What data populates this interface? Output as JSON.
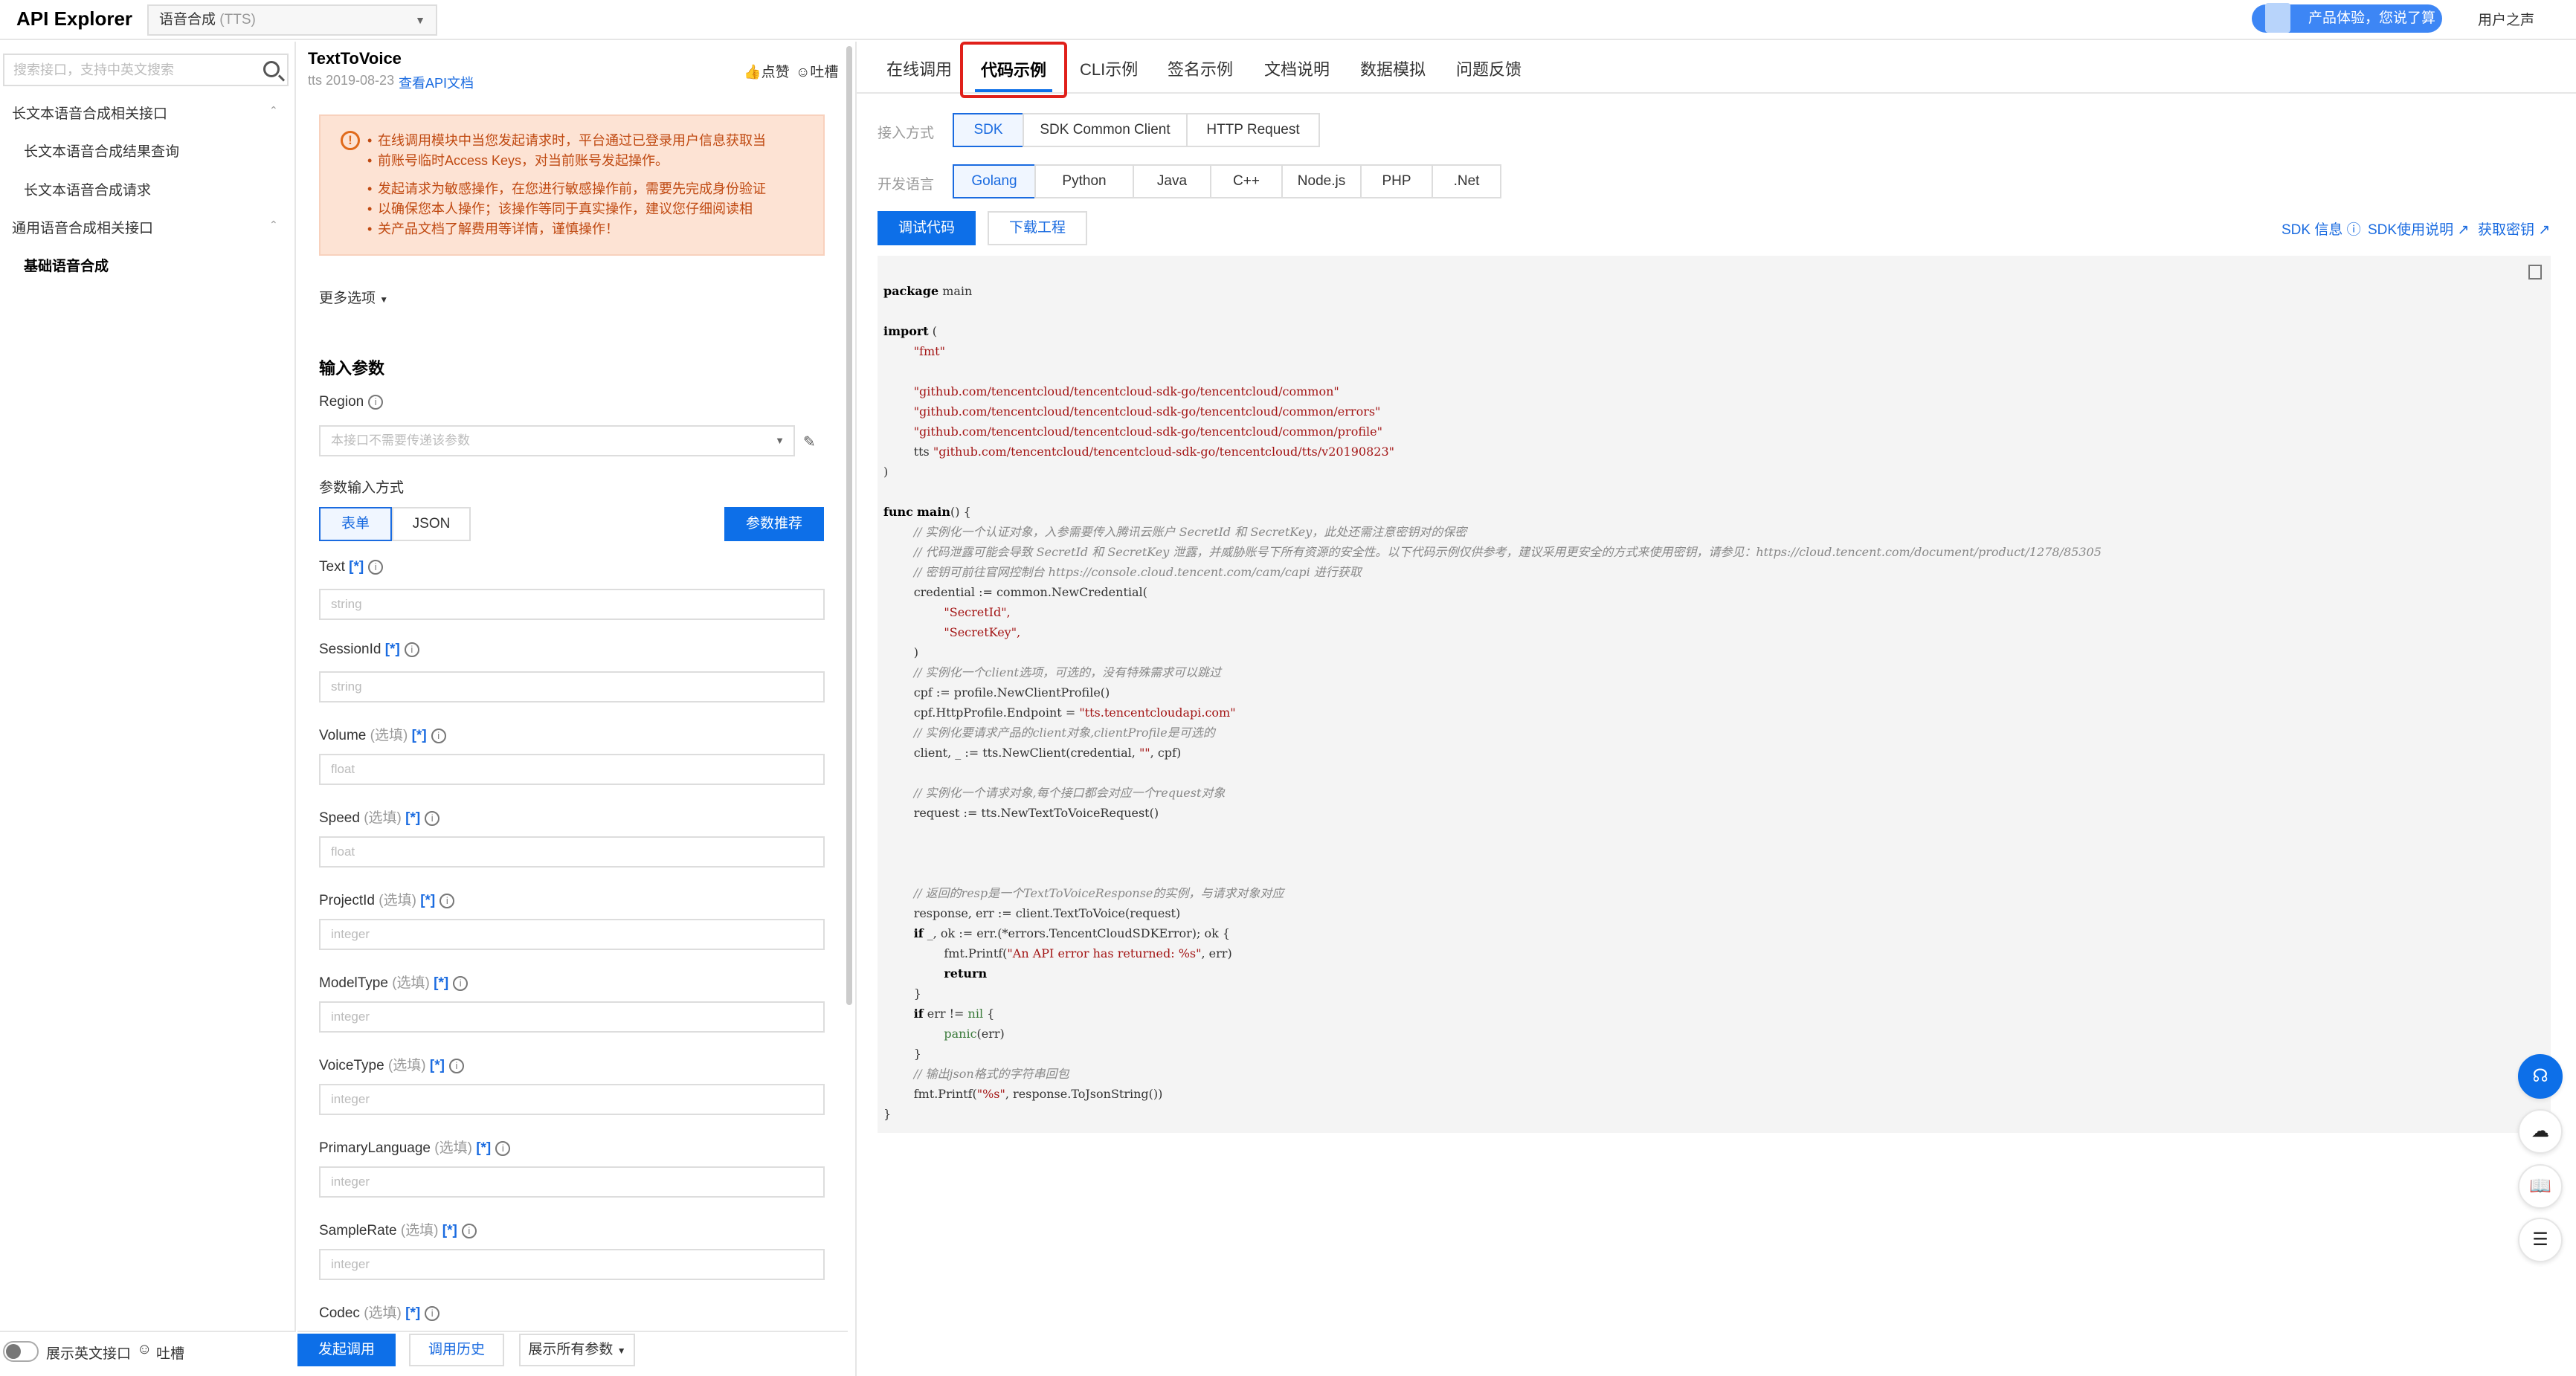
{
  "header": {
    "brand": "API Explorer",
    "product_select": "语音合成",
    "product_code": "(TTS)",
    "promo": "产品体验，您说了算",
    "user_voice": "用户之声"
  },
  "sidebar": {
    "search_placeholder": "搜索接口，支持中英文搜索",
    "groups": [
      {
        "label": "长文本语音合成相关接口",
        "items": [
          "长文本语音合成结果查询",
          "长文本语音合成请求"
        ]
      },
      {
        "label": "通用语音合成相关接口",
        "items": [
          "基础语音合成"
        ]
      }
    ],
    "english_toggle": "展示英文接口",
    "roast": "吐槽"
  },
  "api": {
    "name": "TextToVoice",
    "version": "tts 2019-08-23",
    "doc_link": "查看API文档",
    "like": "点赞",
    "roast": "吐槽"
  },
  "warning": {
    "icon": "warning-circle-icon",
    "lines": [
      "在线调用模块中当您发起请求时，平台通过已登录用户信息获取当",
      "前账号临时Access Keys，对当前账号发起操作。",
      "发起请求为敏感操作，在您进行敏感操作前，需要先完成身份验证",
      "以确保您本人操作；该操作等同于真实操作，建议您仔细阅读相",
      "关产品文档了解费用等详情，谨慎操作！"
    ]
  },
  "form": {
    "more_options": "更多选项",
    "input_params": "输入参数",
    "region_label": "Region",
    "region_placeholder": "本接口不需要传递该参数",
    "mode_label": "参数输入方式",
    "mode_form": "表单",
    "mode_json": "JSON",
    "recommend": "参数推荐",
    "optional": "(选填)",
    "star": "[*]",
    "params": [
      {
        "name": "Text",
        "optional": false,
        "type": "string"
      },
      {
        "name": "SessionId",
        "optional": false,
        "type": "string"
      },
      {
        "name": "Volume",
        "optional": true,
        "type": "float"
      },
      {
        "name": "Speed",
        "optional": true,
        "type": "float"
      },
      {
        "name": "ProjectId",
        "optional": true,
        "type": "integer"
      },
      {
        "name": "ModelType",
        "optional": true,
        "type": "integer"
      },
      {
        "name": "VoiceType",
        "optional": true,
        "type": "integer"
      },
      {
        "name": "PrimaryLanguage",
        "optional": true,
        "type": "integer"
      },
      {
        "name": "SampleRate",
        "optional": true,
        "type": "integer"
      },
      {
        "name": "Codec",
        "optional": true,
        "type": ""
      }
    ],
    "send": "发起调用",
    "history": "调用历史",
    "show_all": "展示所有参数"
  },
  "tabs": [
    "在线调用",
    "代码示例",
    "CLI示例",
    "签名示例",
    "文档说明",
    "数据模拟",
    "问题反馈"
  ],
  "sdk": {
    "access_label": "接入方式",
    "access_options": [
      "SDK",
      "SDK Common Client",
      "HTTP Request"
    ],
    "lang_label": "开发语言",
    "languages": [
      "Golang",
      "Python",
      "Java",
      "C++",
      "Node.js",
      "PHP",
      ".Net"
    ],
    "debug": "调试代码",
    "download": "下载工程",
    "sdk_info": "SDK 信息",
    "sdk_usage": "SDK使用说明",
    "get_key": "获取密钥"
  },
  "code": {
    "package": "main",
    "imports": [
      "\"fmt\"",
      "\"github.com/tencentcloud/tencentcloud-sdk-go/tencentcloud/common\"",
      "\"github.com/tencentcloud/tencentcloud-sdk-go/tencentcloud/common/errors\"",
      "\"github.com/tencentcloud/tencentcloud-sdk-go/tencentcloud/common/profile\"",
      "\"github.com/tencentcloud/tencentcloud-sdk-go/tencentcloud/tts/v20190823\""
    ],
    "c1": "// 实例化一个认证对象，入参需要传入腾讯云账户 SecretId 和 SecretKey，此处还需注意密钥对的保密",
    "c2": "// 代码泄露可能会导致 SecretId 和 SecretKey 泄露，并威胁账号下所有资源的安全性。以下代码示例仅供参考，建议采用更安全的方式来使用密钥，请参见：https://cloud.tencent.com/document/product/1278/85305",
    "c3": "// 密钥可前往官网控制台 https://console.cloud.tencent.com/cam/capi 进行获取",
    "secret_id": "\"SecretId\",",
    "secret_key": "\"SecretKey\",",
    "c4": "// 实例化一个client选项，可选的，没有特殊需求可以跳过",
    "endpoint": "\"tts.tencentcloudapi.com\"",
    "c5": "// 实例化要请求产品的client对象,clientProfile是可选的",
    "c6": "// 实例化一个请求对象,每个接口都会对应一个request对象",
    "c7": "// 返回的resp是一个TextToVoiceResponse的实例，与请求对象对应",
    "err_fmt": "\"An API error has returned: %s\"",
    "c8": "// 输出json格式的字符串回包",
    "out_fmt": "\"%s\""
  },
  "floating": [
    "headset-icon",
    "cloud-icon",
    "book-icon",
    "list-icon"
  ]
}
